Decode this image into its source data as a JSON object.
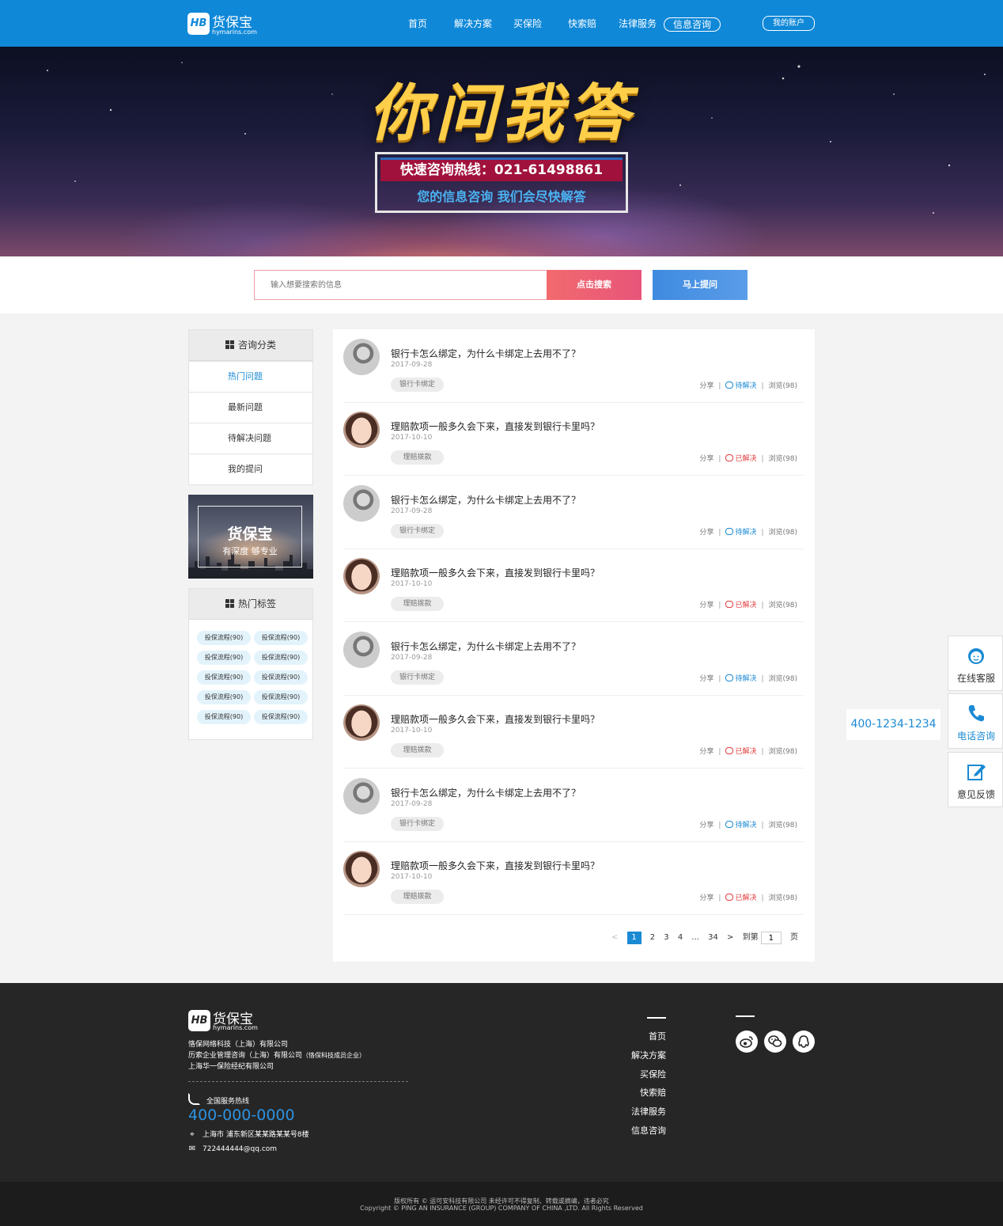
{
  "header": {
    "logo_name": "货保宝",
    "logo_domain": "hymarins.com",
    "nav": [
      "首页",
      "解决方案",
      "买保险",
      "快索赔",
      "法律服务",
      "信息咨询"
    ],
    "active_nav": "信息咨询",
    "account_label": "我的账户",
    "brand_color": "#0f88d8"
  },
  "banner": {
    "title": "你问我答",
    "hotline": "快速咨询热线：021-61498861",
    "subtitle": "您的信息咨询  我们会尽快解答"
  },
  "search": {
    "placeholder": "输入想要搜索的信息",
    "search_button": "点击搜索",
    "ask_button": "马上提问"
  },
  "sidebar": {
    "category_title": "咨询分类",
    "categories": [
      "热门问题",
      "最新问题",
      "待解决问题",
      "我的提问"
    ],
    "active_category": "热门问题",
    "promo_title": "货保宝",
    "promo_sub": "有深度  够专业",
    "tags_title": "热门标签",
    "tags": [
      "投保流程(90)",
      "投保流程(90)",
      "投保流程(90)",
      "投保流程(90)",
      "投保流程(90)",
      "投保流程(90)",
      "投保流程(90)",
      "投保流程(90)",
      "投保流程(90)",
      "投保流程(90)"
    ]
  },
  "questions": [
    {
      "title": "银行卡怎么绑定，为什么卡绑定上去用不了？",
      "date": "2017-09-28",
      "tag": "银行卡绑定",
      "share": "分享",
      "status": "待解决",
      "status_type": "pending",
      "views": "浏览(98)",
      "avatar": "gray"
    },
    {
      "title": "理赔款项一般多久会下来，直接发到银行卡里吗？",
      "date": "2017-10-10",
      "tag": "理赔拨款",
      "share": "分享",
      "status": "已解决",
      "status_type": "solved",
      "views": "浏览(98)",
      "avatar": "girl"
    },
    {
      "title": "银行卡怎么绑定，为什么卡绑定上去用不了？",
      "date": "2017-09-28",
      "tag": "银行卡绑定",
      "share": "分享",
      "status": "待解决",
      "status_type": "pending",
      "views": "浏览(98)",
      "avatar": "gray"
    },
    {
      "title": "理赔款项一般多久会下来，直接发到银行卡里吗？",
      "date": "2017-10-10",
      "tag": "理赔拨款",
      "share": "分享",
      "status": "已解决",
      "status_type": "solved",
      "views": "浏览(98)",
      "avatar": "girl"
    },
    {
      "title": "银行卡怎么绑定，为什么卡绑定上去用不了？",
      "date": "2017-09-28",
      "tag": "银行卡绑定",
      "share": "分享",
      "status": "待解决",
      "status_type": "pending",
      "views": "浏览(98)",
      "avatar": "gray"
    },
    {
      "title": "理赔款项一般多久会下来，直接发到银行卡里吗？",
      "date": "2017-10-10",
      "tag": "理赔拨款",
      "share": "分享",
      "status": "已解决",
      "status_type": "solved",
      "views": "浏览(98)",
      "avatar": "girl"
    },
    {
      "title": "银行卡怎么绑定，为什么卡绑定上去用不了？",
      "date": "2017-09-28",
      "tag": "银行卡绑定",
      "share": "分享",
      "status": "待解决",
      "status_type": "pending",
      "views": "浏览(98)",
      "avatar": "gray"
    },
    {
      "title": "理赔款项一般多久会下来，直接发到银行卡里吗？",
      "date": "2017-10-10",
      "tag": "理赔拨款",
      "share": "分享",
      "status": "已解决",
      "status_type": "solved",
      "views": "浏览(98)",
      "avatar": "girl"
    }
  ],
  "pagination": {
    "prev": "<",
    "pages": [
      "1",
      "2",
      "3",
      "4",
      "...",
      "34"
    ],
    "current": "1",
    "next": ">",
    "goto_label": "到第",
    "goto_value": "1",
    "page_suffix": "页"
  },
  "float_tools": {
    "phone": "400-1234-1234",
    "online_service": "在线客服",
    "phone_consult": "电话咨询",
    "feedback": "意见反馈"
  },
  "footer": {
    "logo_name": "货保宝",
    "logo_domain": "hymarins.com",
    "company1": "恪保网络科技（上海）有限公司",
    "company2": "历索企业管理咨询（上海）有限公司",
    "company2_note": "（恪保科技成员企业）",
    "company3": "上海华一保险经纪有限公司",
    "hotline_label": "全国服务热线",
    "hotline": "400-000-0000",
    "address": "上海市  浦东新区某某路某某号8楼",
    "email": "722444444@qq.com",
    "nav": [
      "首页",
      "解决方案",
      "买保险",
      "快索赔",
      "法律服务",
      "信息咨询"
    ],
    "social": [
      "weibo-icon",
      "wechat-icon",
      "qq-icon"
    ],
    "copyright_cn": "版权所有 © 运可安科技有限公司 未经许可不得复制、转载或摘编，违者必究",
    "copyright_en": "Copyright © PING AN INSURANCE (GROUP) COMPANY OF CHINA ,LTD. All Rights Reserved"
  }
}
